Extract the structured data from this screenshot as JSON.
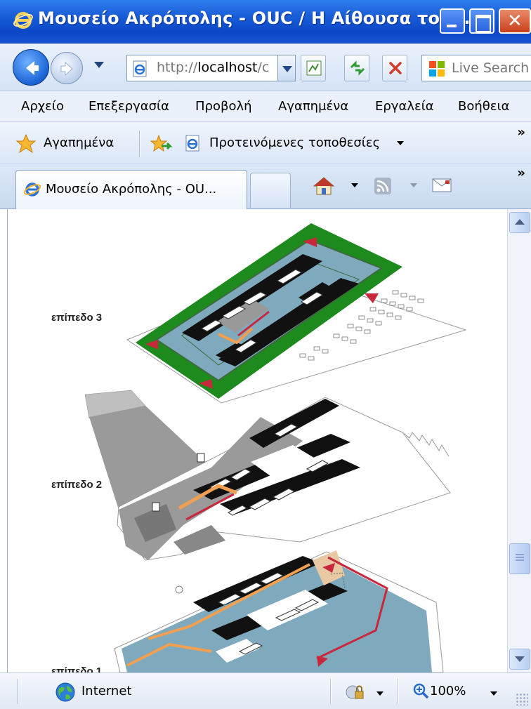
{
  "window": {
    "title": "Μουσείο Ακρόπολης - OUC / Η Αίθουσα του ...",
    "accent": "#1a5fd8"
  },
  "navigation": {
    "address_prefix": "http://",
    "address_host": "localhost",
    "address_rest": "/c",
    "search_placeholder": "Live Search"
  },
  "menu": {
    "items": [
      "Αρχείο",
      "Επεξεργασία",
      "Προβολή",
      "Αγαπημένα",
      "Εργαλεία",
      "Βοήθεια"
    ]
  },
  "favorites_bar": {
    "favorites_label": "Αγαπημένα",
    "suggested_sites": "Προτεινόμενες τοποθεσίες",
    "chevron": "»"
  },
  "tabs": {
    "active_label": "Μουσείο Ακρόπολης - OU...",
    "chevron": "»"
  },
  "content": {
    "level3_label": "επίπεδο 3",
    "level2_label": "επίπεδο 2",
    "level1_label": "επίπεδο 1",
    "colors": {
      "terrace_green": "#1d8a1d",
      "gallery_blue": "#7fa9bd",
      "floor_gray": "#9a9a9a",
      "route_orange": "#f0a050",
      "route_red": "#c8283c"
    }
  },
  "statusbar": {
    "zone": "Internet",
    "zoom": "100%"
  }
}
